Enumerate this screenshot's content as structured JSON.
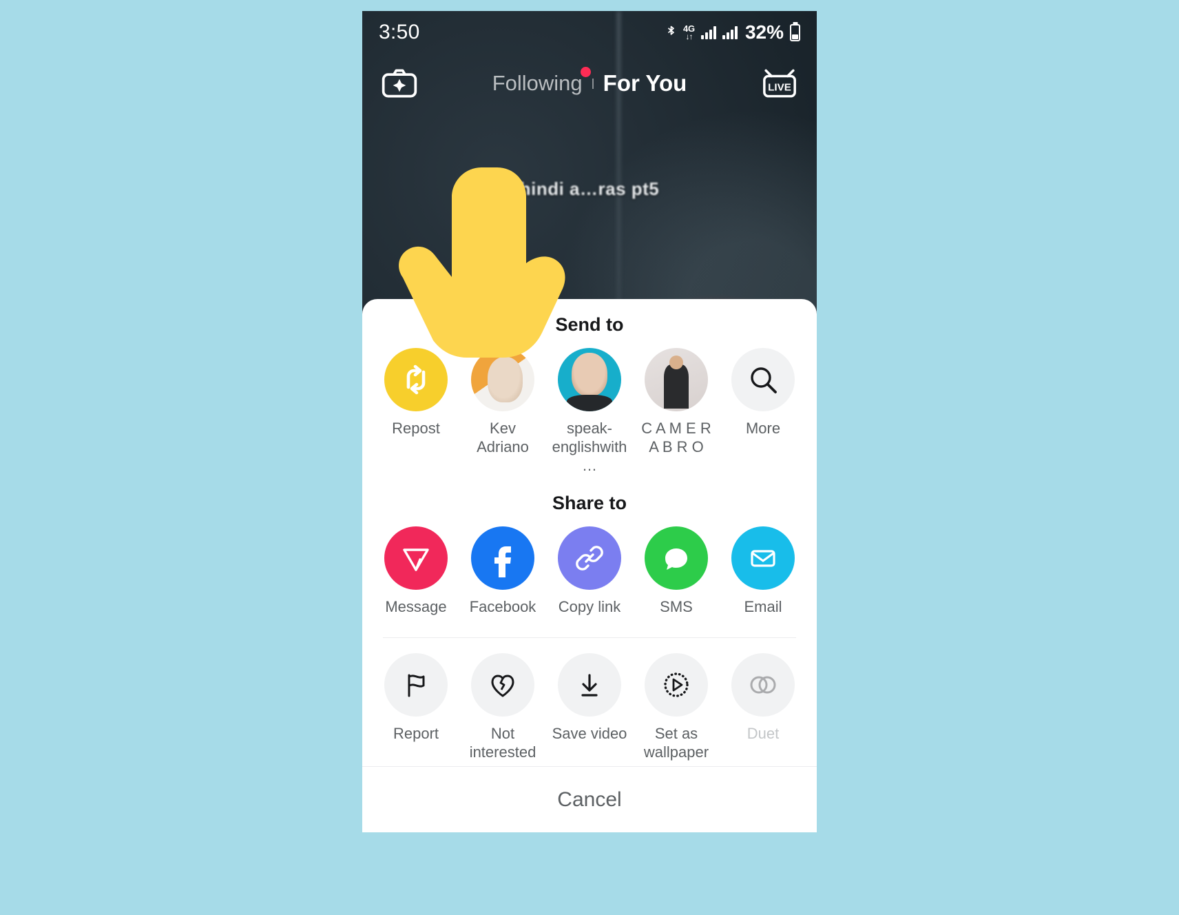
{
  "status_bar": {
    "time": "3:50",
    "bluetooth_icon": "bluetooth-icon",
    "network_type": "4G",
    "network_arrows": "↓↑",
    "battery_percent": "32%"
  },
  "video": {
    "camera_icon": "camera-effects-icon",
    "tab_following": "Following",
    "tab_for_you": "For You",
    "live_icon": "live-icon",
    "caption": "hindi a…ras pt5",
    "cursor_icon": "pointing-hand-cursor"
  },
  "sheet": {
    "send_to_title": "Send to",
    "send_to": [
      {
        "label": "Repost",
        "icon": "repost-icon",
        "kind": "repost"
      },
      {
        "label": "Kev Adriano",
        "icon": "avatar",
        "kind": "kev"
      },
      {
        "label": "speak-englishwith…",
        "icon": "avatar",
        "kind": "speak"
      },
      {
        "label": "C A M E R A B R O",
        "icon": "avatar",
        "kind": "cam"
      },
      {
        "label": "More",
        "icon": "search-icon",
        "kind": "more"
      }
    ],
    "share_to_title": "Share to",
    "share_to": [
      {
        "label": "Message",
        "icon": "paper-plane-icon",
        "color": "#f1285a"
      },
      {
        "label": "Facebook",
        "icon": "facebook-icon",
        "color": "#1877f2"
      },
      {
        "label": "Copy link",
        "icon": "chain-link-icon",
        "color": "#7b7ef0"
      },
      {
        "label": "SMS",
        "icon": "chat-bubble-icon",
        "color": "#2dcc4a"
      },
      {
        "label": "Email",
        "icon": "envelope-icon",
        "color": "#18bdea"
      }
    ],
    "actions": [
      {
        "label": "Report",
        "icon": "flag-icon",
        "disabled": false
      },
      {
        "label": "Not interested",
        "icon": "broken-heart-icon",
        "disabled": false
      },
      {
        "label": "Save video",
        "icon": "download-icon",
        "disabled": false
      },
      {
        "label": "Set as wallpaper",
        "icon": "dotted-play-icon",
        "disabled": false
      },
      {
        "label": "Duet",
        "icon": "duet-circles-icon",
        "disabled": true
      }
    ],
    "cancel_label": "Cancel"
  },
  "colors": {
    "page_background": "#a6dbe8",
    "accent_red": "#fe2c55",
    "repost_yellow": "#f7cf2c",
    "cursor_yellow": "#fdd54f"
  }
}
